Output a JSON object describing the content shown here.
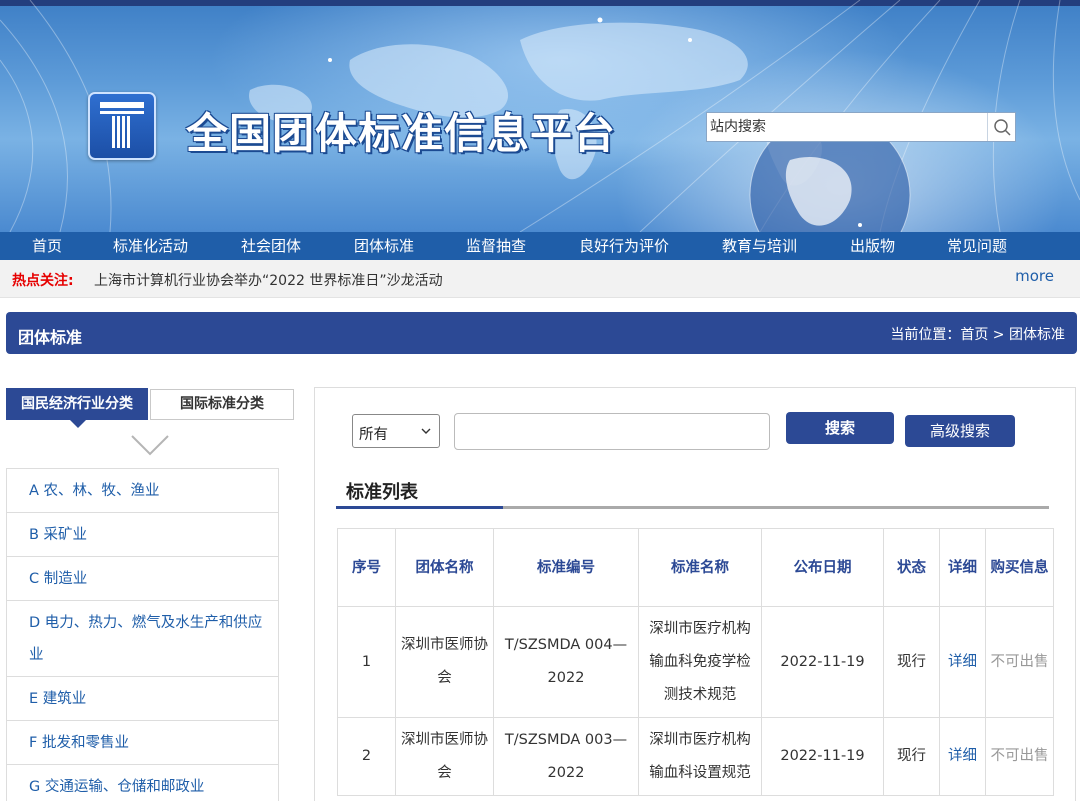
{
  "header": {
    "site_title": "全国团体标准信息平台",
    "search_placeholder": "站内搜索",
    "brand_color": "#2c4995"
  },
  "nav": {
    "items": [
      "首页",
      "标准化活动",
      "社会团体",
      "团体标准",
      "监督抽查",
      "良好行为评价",
      "教育与培训",
      "出版物",
      "常见问题"
    ]
  },
  "hotbar": {
    "label": "热点关注:",
    "news": "上海市计算机行业协会举办“2022 世界标准日”沙龙活动",
    "more": "more"
  },
  "section": {
    "title": "团体标准",
    "breadcrumb": "当前位置：首页 > 团体标准"
  },
  "sidebar": {
    "tabs": [
      "国民经济行业分类",
      "国际标准分类"
    ],
    "categories": [
      "A 农、林、牧、渔业",
      "B 采矿业",
      "C 制造业",
      "D 电力、热力、燃气及水生产和供应业",
      "E 建筑业",
      "F 批发和零售业",
      "G 交通运输、仓储和邮政业"
    ]
  },
  "search": {
    "select_value": "所有",
    "keyword": "",
    "search_label": "搜索",
    "advanced_label": "高级搜索"
  },
  "list": {
    "title": "标准列表",
    "columns": [
      "序号",
      "团体名称",
      "标准编号",
      "标准名称",
      "公布日期",
      "状态",
      "详细",
      "购买信息"
    ],
    "rows": [
      {
        "no": "1",
        "org": "深圳市医师协会",
        "code": "T/SZSMDA 004—2022",
        "name": "深圳市医疗机构输血科免疫学检测技术规范",
        "date": "2022-11-19",
        "status": "现行",
        "detail": "详细",
        "buy": "不可出售"
      },
      {
        "no": "2",
        "org": "深圳市医师协会",
        "code": "T/SZSMDA 003—2022",
        "name": "深圳市医疗机构输血科设置规范",
        "date": "2022-11-19",
        "status": "现行",
        "detail": "详细",
        "buy": "不可出售"
      }
    ]
  }
}
